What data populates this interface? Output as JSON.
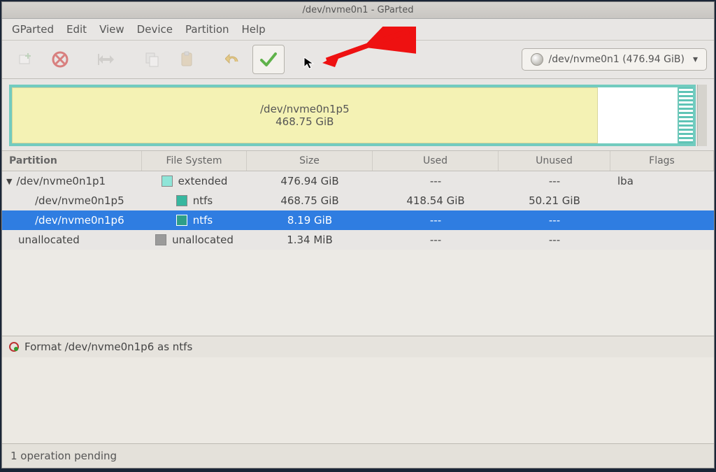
{
  "titlebar": "/dev/nvme0n1 - GParted",
  "menu": {
    "gparted": "GParted",
    "edit": "Edit",
    "view": "View",
    "device": "Device",
    "partition": "Partition",
    "help": "Help"
  },
  "device_combo": {
    "label": "/dev/nvme0n1 (476.94 GiB)"
  },
  "graph": {
    "big_name": "/dev/nvme0n1p5",
    "big_size": "468.75 GiB"
  },
  "columns": {
    "partition": "Partition",
    "filesystem": "File System",
    "size": "Size",
    "used": "Used",
    "unused": "Unused",
    "flags": "Flags"
  },
  "rows": [
    {
      "indent": 0,
      "expander": true,
      "name": "/dev/nvme0n1p1",
      "swatch": "c-ext",
      "fs": "extended",
      "size": "476.94 GiB",
      "used": "---",
      "unused": "---",
      "flags": "lba",
      "selected": false
    },
    {
      "indent": 1,
      "expander": false,
      "name": "/dev/nvme0n1p5",
      "swatch": "c-ntfs",
      "fs": "ntfs",
      "size": "468.75 GiB",
      "used": "418.54 GiB",
      "unused": "50.21 GiB",
      "flags": "",
      "selected": false
    },
    {
      "indent": 1,
      "expander": false,
      "name": "/dev/nvme0n1p6",
      "swatch": "c-ntfs2",
      "fs": "ntfs",
      "size": "8.19 GiB",
      "used": "---",
      "unused": "---",
      "flags": "",
      "selected": true
    },
    {
      "indent": 0,
      "expander": false,
      "name": "unallocated",
      "swatch": "c-unalloc",
      "fs": "unallocated",
      "size": "1.34 MiB",
      "used": "---",
      "unused": "---",
      "flags": "",
      "selected": false
    }
  ],
  "operation": "Format /dev/nvme0n1p6 as ntfs",
  "status": "1 operation pending"
}
